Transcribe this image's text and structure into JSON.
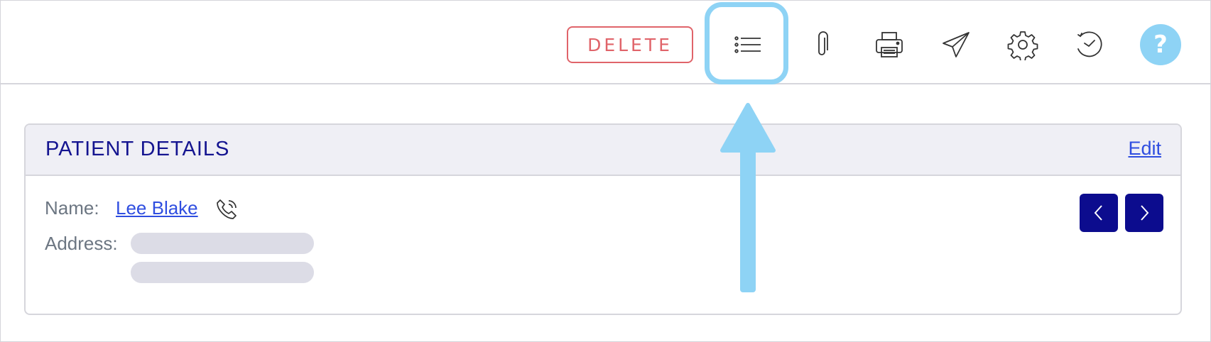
{
  "toolbar": {
    "delete_label": "DELETE",
    "icons": [
      "list-icon",
      "paperclip-icon",
      "printer-icon",
      "send-icon",
      "gear-icon",
      "history-icon"
    ],
    "help_label": "?"
  },
  "patient": {
    "section_title": "PATIENT DETAILS",
    "edit_label": "Edit",
    "name_label": "Name:",
    "name_value": "Lee Blake",
    "address_label": "Address:"
  },
  "colors": {
    "accent": "#0c0c8e",
    "link": "#2f4ee0",
    "danger": "#e0646a",
    "highlight": "#8ed3f5"
  }
}
